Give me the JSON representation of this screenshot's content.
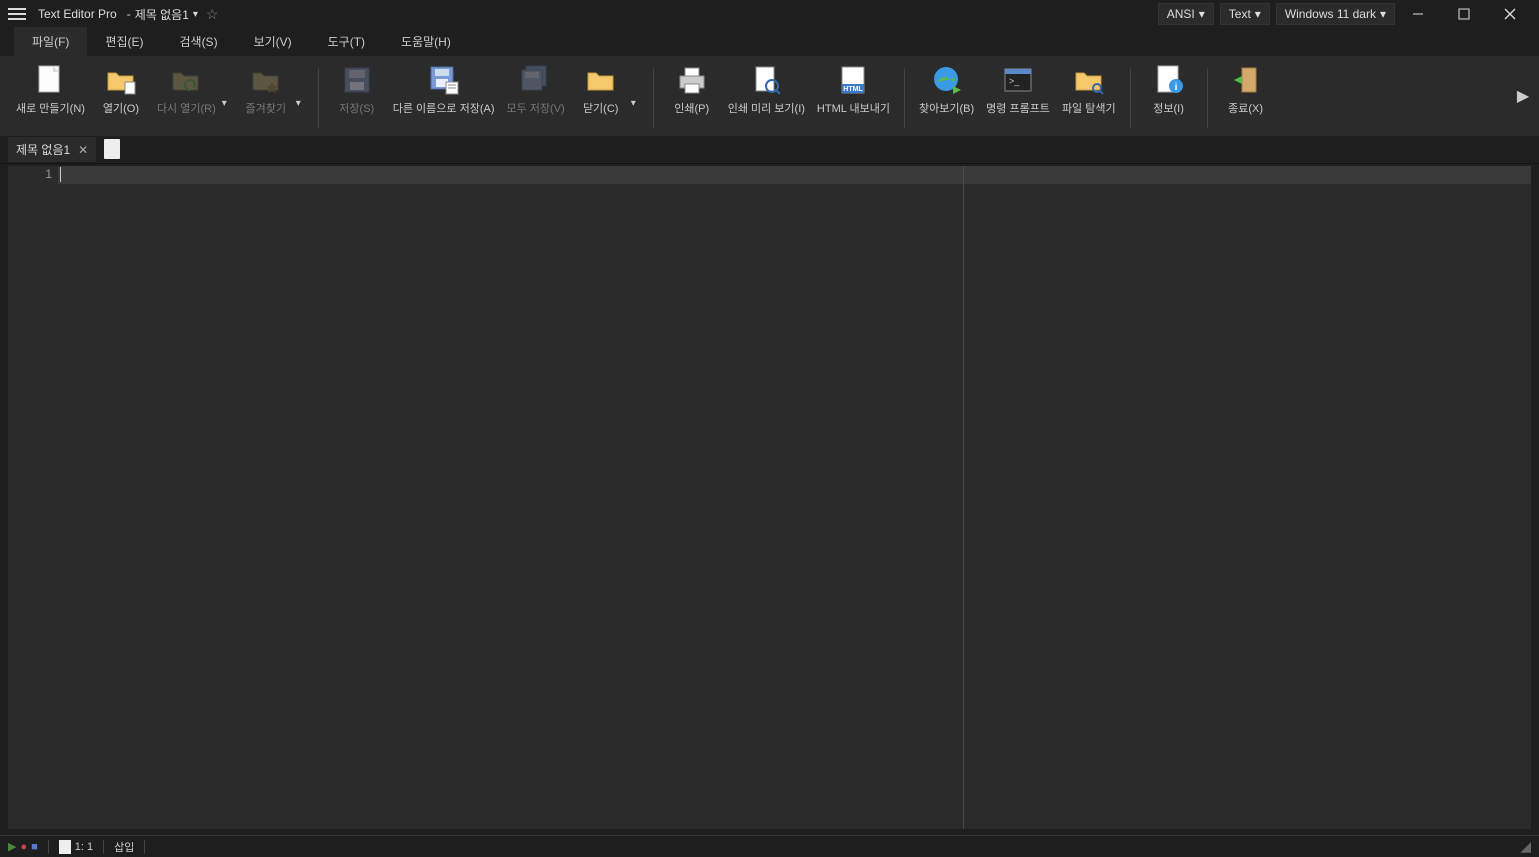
{
  "titlebar": {
    "app_name": "Text Editor Pro",
    "separator": "  -  ",
    "document": "제목 없음1",
    "dropdowns": {
      "encoding": "ANSI",
      "mode": "Text",
      "theme": "Windows 11 dark"
    }
  },
  "menutabs": [
    {
      "label": "파일(F)",
      "active": true
    },
    {
      "label": "편집(E)",
      "active": false
    },
    {
      "label": "검색(S)",
      "active": false
    },
    {
      "label": "보기(V)",
      "active": false
    },
    {
      "label": "도구(T)",
      "active": false
    },
    {
      "label": "도움말(H)",
      "active": false
    }
  ],
  "ribbon": {
    "new": "새로 만들기(N)",
    "open": "열기(O)",
    "reopen": "다시 열기(R)",
    "favorites": "즐겨찾기",
    "save": "저장(S)",
    "save_as": "다른 이름으로 저장(A)",
    "save_all": "모두 저장(V)",
    "close": "닫기(C)",
    "print": "인쇄(P)",
    "print_preview": "인쇄 미리 보기(I)",
    "html_export": "HTML 내보내기",
    "browse": "찾아보기(B)",
    "cmd": "명령 프롬프트",
    "explorer": "파일 탐색기",
    "info": "정보(I)",
    "exit": "종료(X)"
  },
  "doctab": {
    "label": "제목 없음1"
  },
  "editor": {
    "line1": "1"
  },
  "statusbar": {
    "position": "1: 1",
    "mode": "삽입"
  }
}
